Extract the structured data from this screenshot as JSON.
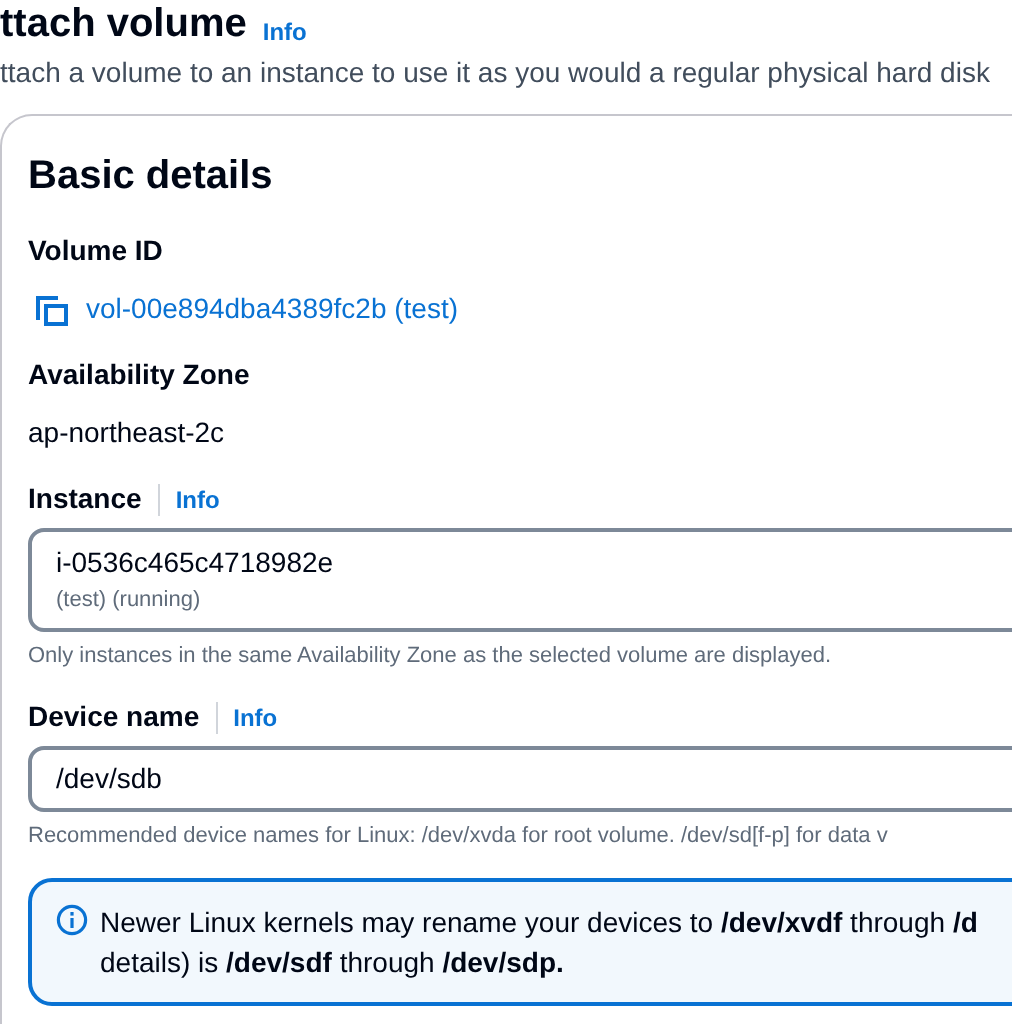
{
  "header": {
    "title": "ttach volume",
    "info": "Info",
    "description": "ttach a volume to an instance to use it as you would a regular physical hard disk"
  },
  "section": {
    "title": "Basic details",
    "fields": [
      {
        "kind": "copy",
        "label": "Volume ID",
        "value": "vol-00e894dba4389fc2b (test)"
      },
      {
        "kind": "text",
        "label": "Availability Zone",
        "value": "ap-northeast-2c"
      },
      {
        "kind": "select",
        "label": "Instance",
        "info": "Info",
        "value": "i-0536c465c4718982e",
        "secondary": "(test) (running)",
        "hint": "Only instances in the same Availability Zone as the selected volume are displayed."
      },
      {
        "kind": "input",
        "label": "Device name",
        "info": "Info",
        "value": "/dev/sdb",
        "hint": "Recommended device names for Linux: /dev/xvda for root volume. /dev/sd[f-p] for data v"
      }
    ],
    "alert": {
      "lines": [
        "Newer Linux kernels may rename your devices to **/dev/xvdf** through **/d**",
        "details) is **/dev/sdf** through **/dev/sdp.**"
      ]
    }
  }
}
